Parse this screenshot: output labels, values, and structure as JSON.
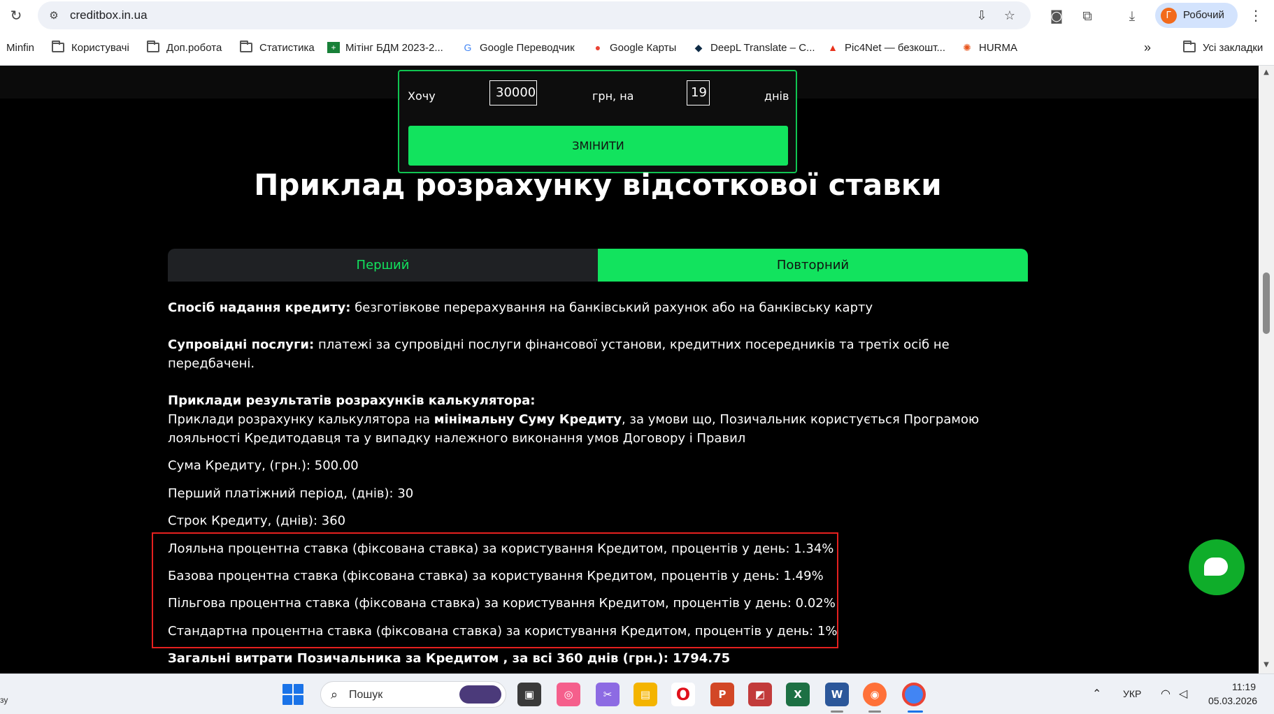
{
  "browser": {
    "url": "creditbox.in.ua",
    "profile_initial": "Г",
    "profile_label": "Робочий",
    "bookmarks": [
      {
        "label": "Minfin",
        "icon": "none"
      },
      {
        "label": "Користувачі",
        "icon": "folder-icon"
      },
      {
        "label": "Доп.робота",
        "icon": "folder-icon"
      },
      {
        "label": "Статистика",
        "icon": "folder-icon"
      },
      {
        "label": "Мітінг БДМ 2023-2...",
        "icon": "sheets-icon"
      },
      {
        "label": "Google Переводчик",
        "icon": "translate-icon"
      },
      {
        "label": "Google Карты",
        "icon": "maps-pin-icon"
      },
      {
        "label": "DeepL Translate – С...",
        "icon": "deepl-icon"
      },
      {
        "label": "Pic4Net — безкошт...",
        "icon": "pic4net-icon"
      },
      {
        "label": "HURMA",
        "icon": "hurma-icon"
      }
    ],
    "overflow_label": "»",
    "all_bookmarks_label": "Усі закладки"
  },
  "calculator": {
    "want_label": "Хочу",
    "amount_value": "30000",
    "currency_label": "грн, на",
    "days_value": "19",
    "days_label": "днів",
    "change_button": "ЗМІНИТИ"
  },
  "page": {
    "title": "Приклад розрахунку відсоткової ставки",
    "tabs": [
      {
        "label": "Перший",
        "active": false
      },
      {
        "label": "Повторний",
        "active": true
      }
    ],
    "method_label": "Спосіб надання кредиту:",
    "method_text": " безготівкове перерахування на банківський рахунок або на банківську карту",
    "services_label": "Супровідні послуги:",
    "services_text_line1": " платежі за супровідні послуги фінансової установи, кредитних посередників та третіх осіб не",
    "services_text_line2": "передбачені.",
    "examples_heading": "Приклади результатів розрахунків калькулятора:",
    "examples_line1_a": "Приклади розрахунку калькулятора на ",
    "examples_line1_b": "мінімальну Суму Кредиту",
    "examples_line1_c": ", за умови що, Позичальник користується Програмою",
    "examples_line2": "лояльності Кредитодавця та у випадку належного виконання умов Договору і Правил",
    "loan_sum": "Сума Кредиту, (грн.): 500.00",
    "first_period": "Перший платіжний період, (днів): 30",
    "loan_term": "Строк Кредиту, (днів): 360",
    "rate_loyal": "Лояльна процентна ставка (фіксована ставка) за користування Кредитом, процентів у день: 1.34%",
    "rate_base": "Базова процентна ставка (фіксована ставка) за користування Кредитом, процентів у день: 1.49%",
    "rate_preferential": "Пільгова процентна ставка (фіксована ставка) за користування Кредитом, процентів у день: 0.02%",
    "rate_standard": "Стандартна процентна ставка (фіксована ставка) за користування Кредитом, процентів у день: 1%",
    "total_costs": "Загальні витрати Позичальника за Кредитом , за всі 360 днів (грн.): 1794.75"
  },
  "taskbar": {
    "search_placeholder": "Пошук",
    "language": "УКР",
    "time": "11:19",
    "date": "05.03.2026",
    "corner_text": "зу"
  },
  "colors": {
    "accent_green": "#12e35e",
    "tab_inactive_bg": "#1f2124",
    "highlight_red": "#e5201f",
    "chat_green": "#0fad2a"
  }
}
